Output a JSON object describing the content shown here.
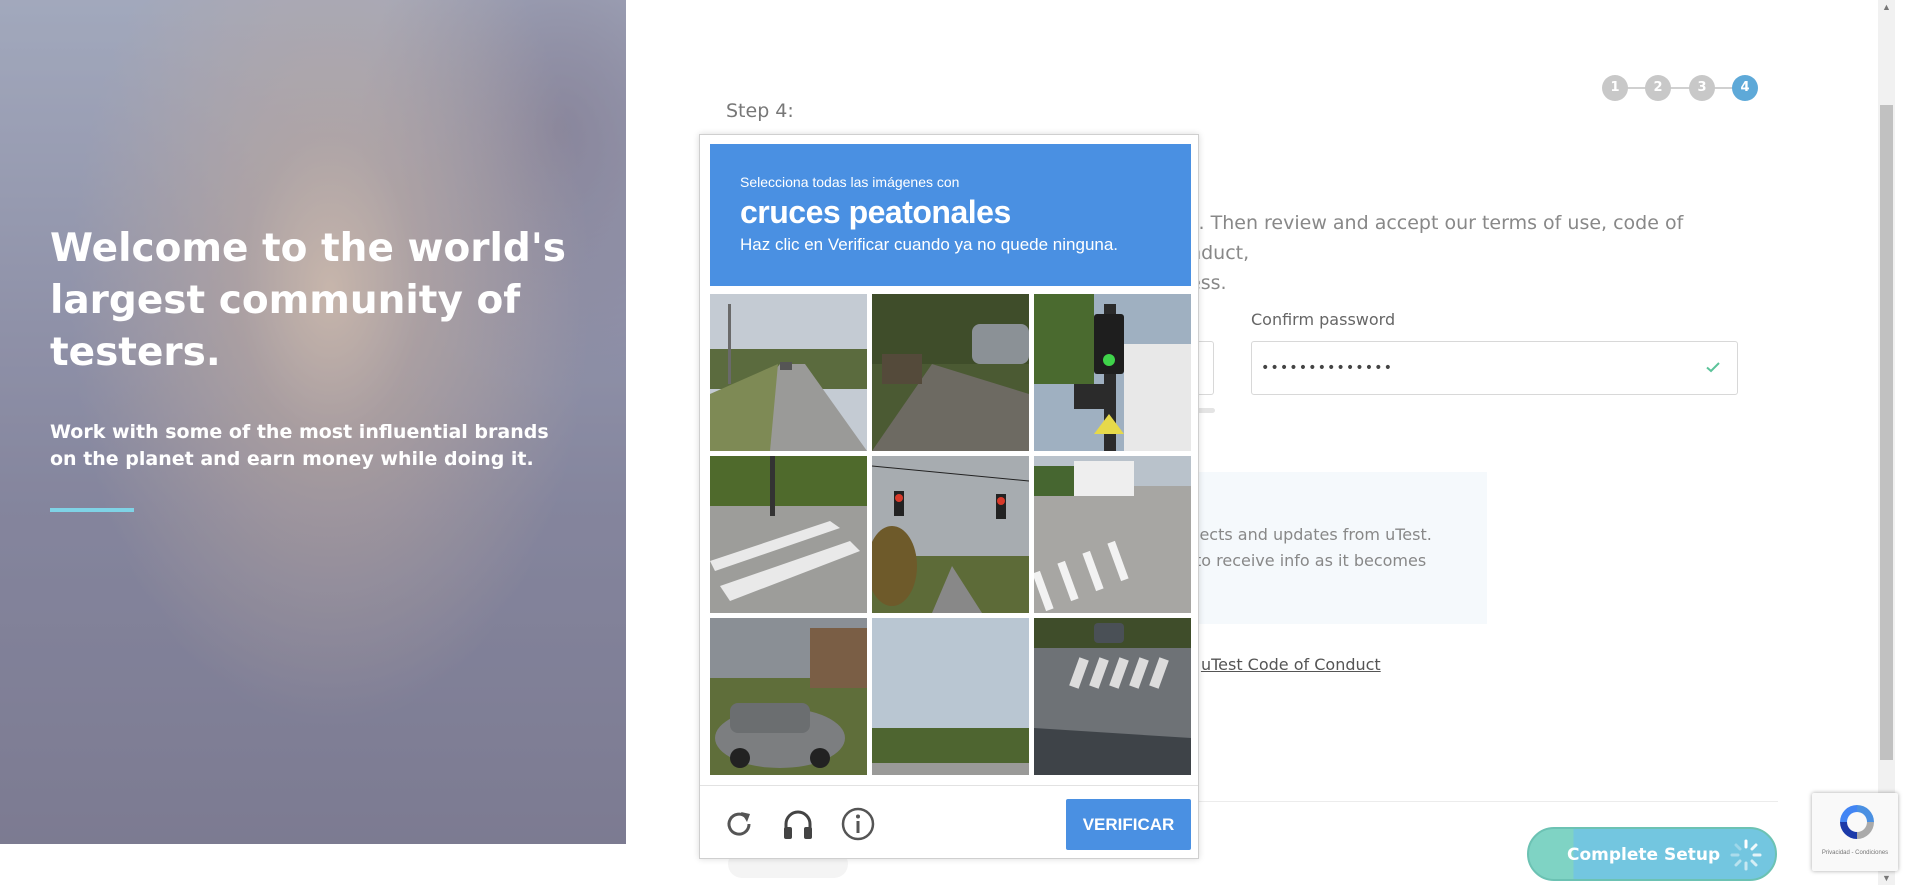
{
  "hero": {
    "title": "Welcome to the world's largest community of testers.",
    "subtitle": "Work with some of the most influential brands on the planet and earn money while doing it."
  },
  "stepper": {
    "steps": [
      "1",
      "2",
      "3",
      "4"
    ],
    "active": 4
  },
  "form": {
    "step_label": "Step 4:",
    "intro_line1": "unt. Then review and accept our terms of use, code of conduct,",
    "intro_line2": "ocess.",
    "confirm_password_label": "Confirm password",
    "confirm_password_value": "••••••••••••••",
    "newsletter_line1": "jects and updates from uTest.",
    "newsletter_line2": "to receive info as it becomes",
    "coc_prefix": "e ",
    "coc_link": "uTest Code of Conduct",
    "complete_button": "Complete Setup"
  },
  "captcha": {
    "select_text": "Selecciona todas las imágenes con",
    "keyword": "cruces peatonales",
    "instruction": "Haz clic en Verificar cuando ya no quede ninguna.",
    "verify_button": "VERIFICAR",
    "tiles": [
      "road-with-car",
      "parked-car-street",
      "traffic-light-sign",
      "crosswalk-left",
      "traffic-lights-red",
      "truck-crosswalk",
      "car-driveway",
      "sky-field",
      "crosswalk-street"
    ],
    "icons": [
      "reload-icon",
      "audio-icon",
      "info-icon"
    ]
  },
  "recaptcha_badge": {
    "text": "Privacidad - Condiciones"
  },
  "colors": {
    "captcha_blue": "#4a90e2",
    "step_active": "#5ea9d8",
    "button_teal": "#73c6e0"
  }
}
